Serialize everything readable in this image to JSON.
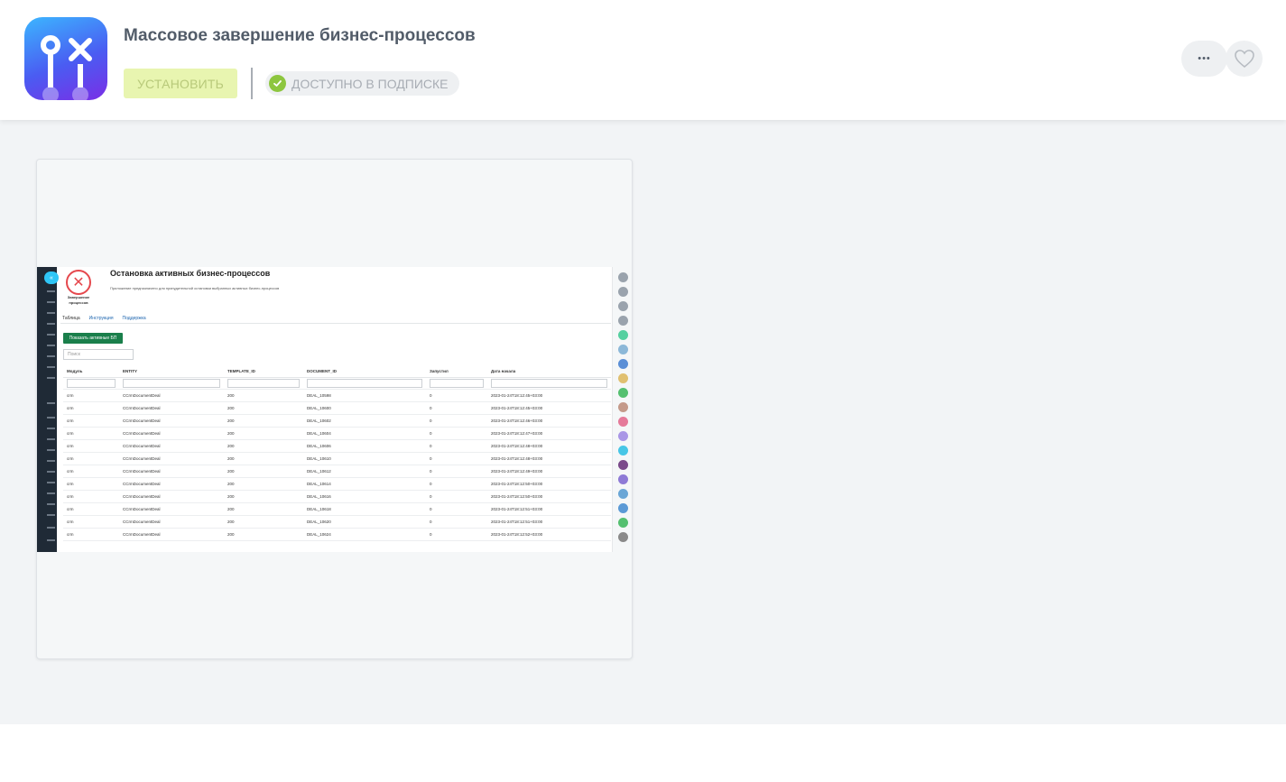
{
  "header": {
    "app_title": "Массовое завершение бизнес-процессов",
    "install_label": "Установить",
    "subscription_label": "Доступно в подписке",
    "more_label": "•••",
    "accent_install_bg": "#e8f5b0",
    "accent_check": "#8dc63f"
  },
  "screenshot": {
    "title": "Остановка активных бизнес-процессов",
    "description": "Приложение предназначено для принудительной остановки выбранных активных бизнес-процессов",
    "logo_label": "Завершение процессов",
    "tabs": [
      {
        "label": "Таблица"
      },
      {
        "label": "Инструкция"
      },
      {
        "label": "Поддержка"
      }
    ],
    "show_active_button": "Показать активные БП",
    "search_placeholder": "Поиск",
    "columns": [
      "Модуль",
      "ENTITY",
      "TEMPLATE_ID",
      "DOCUMENT_ID",
      "Запустил",
      "Дата начала"
    ],
    "rows": [
      [
        "crm",
        "CCrmDocumentDeal",
        "200",
        "DEAL_10598",
        "0",
        "2023-01-24T18:12:45+03:00"
      ],
      [
        "crm",
        "CCrmDocumentDeal",
        "200",
        "DEAL_10600",
        "0",
        "2023-01-24T18:12:45+03:00"
      ],
      [
        "crm",
        "CCrmDocumentDeal",
        "200",
        "DEAL_10602",
        "0",
        "2023-01-24T18:12:46+03:00"
      ],
      [
        "crm",
        "CCrmDocumentDeal",
        "200",
        "DEAL_10604",
        "0",
        "2023-01-24T18:12:47+03:00"
      ],
      [
        "crm",
        "CCrmDocumentDeal",
        "200",
        "DEAL_10606",
        "0",
        "2023-01-24T18:12:48+03:00"
      ],
      [
        "crm",
        "CCrmDocumentDeal",
        "200",
        "DEAL_10610",
        "0",
        "2023-01-24T18:12:48+03:00"
      ],
      [
        "crm",
        "CCrmDocumentDeal",
        "200",
        "DEAL_10612",
        "0",
        "2023-01-24T18:12:49+03:00"
      ],
      [
        "crm",
        "CCrmDocumentDeal",
        "200",
        "DEAL_10614",
        "0",
        "2023-01-24T18:12:50+03:00"
      ],
      [
        "crm",
        "CCrmDocumentDeal",
        "200",
        "DEAL_10616",
        "0",
        "2023-01-24T18:12:50+03:00"
      ],
      [
        "crm",
        "CCrmDocumentDeal",
        "200",
        "DEAL_10618",
        "0",
        "2023-01-24T18:12:51+03:00"
      ],
      [
        "crm",
        "CCrmDocumentDeal",
        "200",
        "DEAL_10620",
        "0",
        "2023-01-24T18:12:51+03:00"
      ],
      [
        "crm",
        "CCrmDocumentDeal",
        "200",
        "DEAL_10624",
        "0",
        "2023-01-24T18:12:52+03:00"
      ]
    ],
    "right_dots": [
      "#9aa3ad",
      "#9aa3ad",
      "#9aa3ad",
      "#9aa3ad",
      "#55d0a0",
      "#8cb8d8",
      "#5b8fd6",
      "#e0c070",
      "#55c070",
      "#c49a8a",
      "#e57a9a",
      "#a996e6",
      "#47c6e6",
      "#7a4a8a",
      "#8e7ad6",
      "#6aa6d6",
      "#5b9ad6",
      "#55c070",
      "#8a8a8a"
    ]
  }
}
